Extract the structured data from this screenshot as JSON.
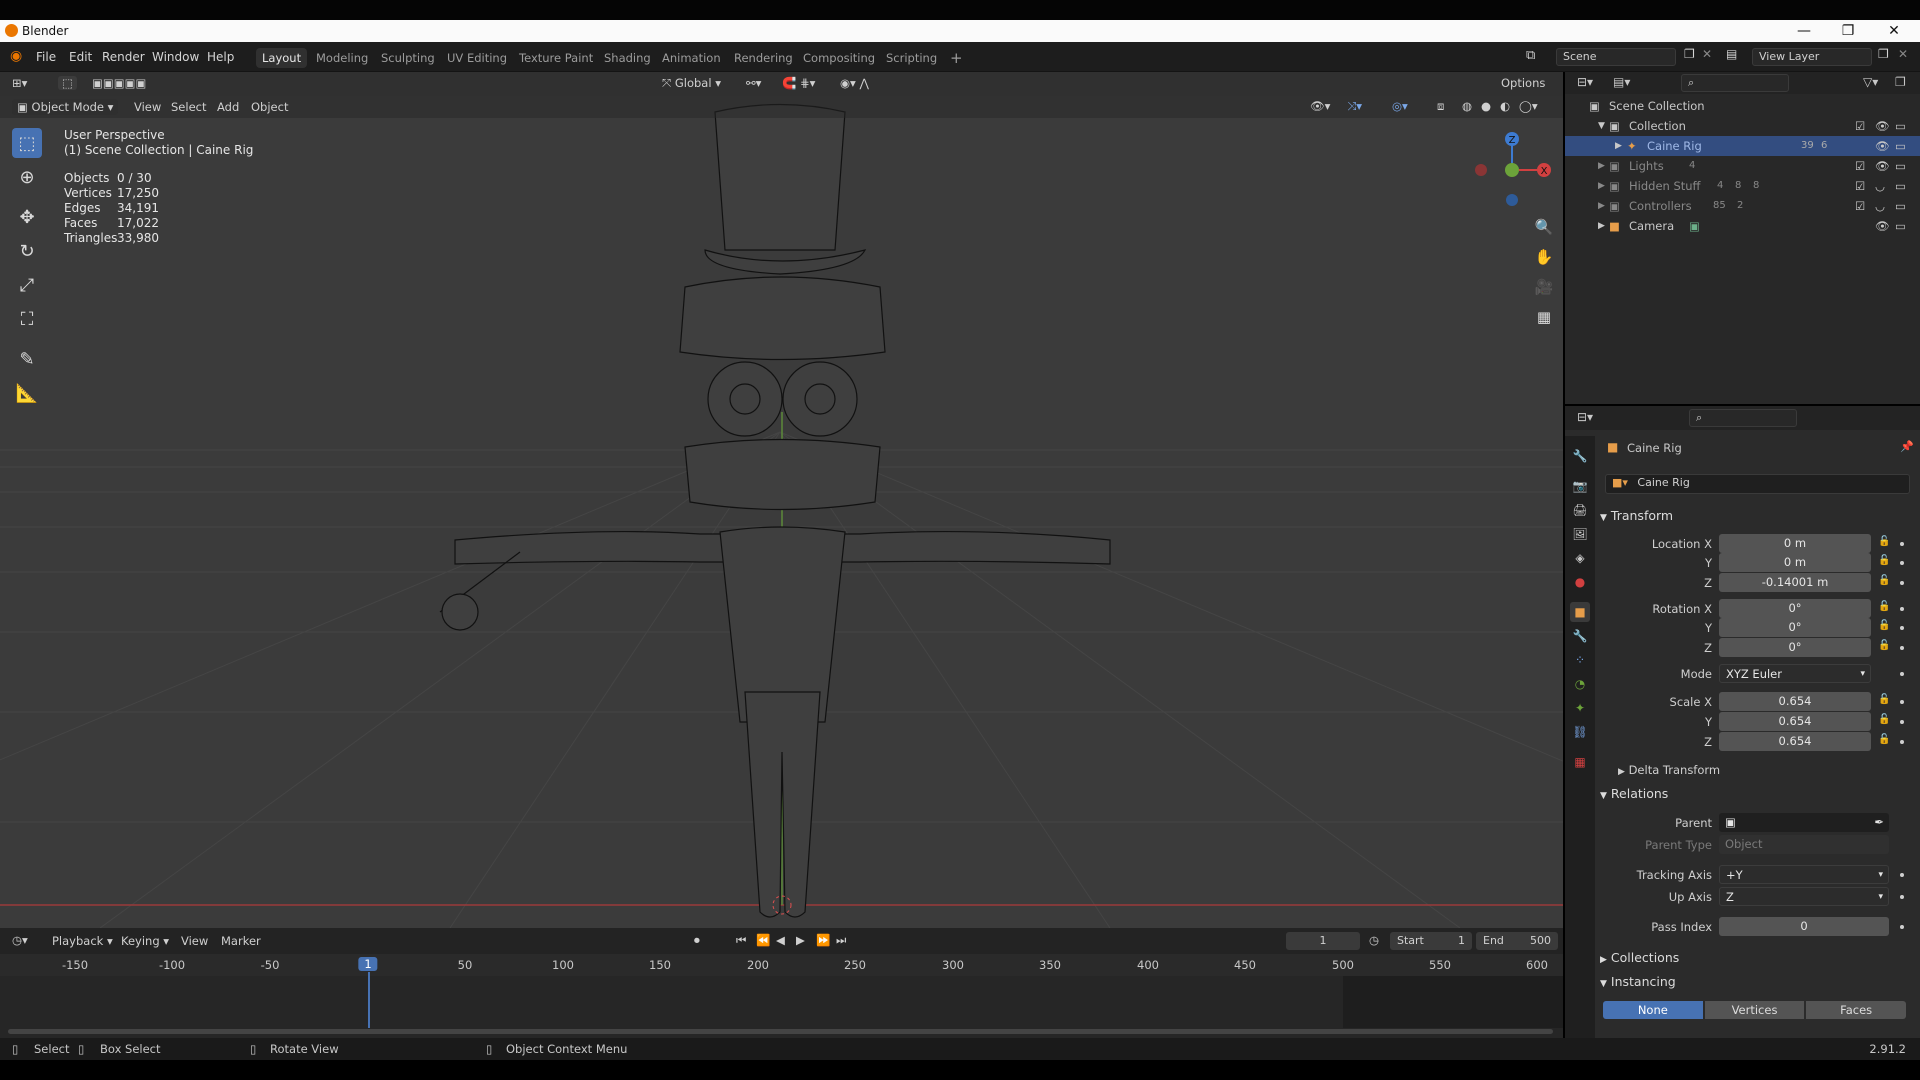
{
  "app": {
    "title": "Blender",
    "version": "2.91.2"
  },
  "menus": [
    "File",
    "Edit",
    "Render",
    "Window",
    "Help"
  ],
  "workspaces": [
    "Layout",
    "Modeling",
    "Sculpting",
    "UV Editing",
    "Texture Paint",
    "Shading",
    "Animation",
    "Rendering",
    "Compositing",
    "Scripting"
  ],
  "active_workspace": "Layout",
  "scene_name": "Scene",
  "view_layer": "View Layer",
  "viewport": {
    "mode": "Object Mode",
    "menus": [
      "View",
      "Select",
      "Add",
      "Object"
    ],
    "transform_orientation": "Global",
    "options_label": "Options",
    "perspective": "User Perspective",
    "context": "(1) Scene Collection | Caine Rig",
    "stats": [
      {
        "label": "Objects",
        "value": "0 / 30"
      },
      {
        "label": "Vertices",
        "value": "17,250"
      },
      {
        "label": "Edges",
        "value": "34,191"
      },
      {
        "label": "Faces",
        "value": "17,022"
      },
      {
        "label": "Triangles",
        "value": "33,980"
      }
    ],
    "gizmo_axes": {
      "x": "X",
      "z": "Z"
    }
  },
  "outliner": {
    "root": "Scene Collection",
    "items": [
      {
        "name": "Collection",
        "icon": "collection-icon"
      },
      {
        "name": "Caine Rig",
        "icon": "armature-icon",
        "selected": true,
        "badges": [
          "39",
          "6"
        ]
      },
      {
        "name": "Lights",
        "icon": "collection-icon",
        "badges": [
          "4"
        ]
      },
      {
        "name": "Hidden Stuff",
        "icon": "collection-icon",
        "badges": [
          "4",
          "8",
          "8"
        ]
      },
      {
        "name": "Controllers",
        "icon": "collection-icon",
        "badges": [
          "85",
          "2"
        ]
      },
      {
        "name": "Camera",
        "icon": "camera-icon"
      }
    ]
  },
  "properties": {
    "object_name": "Caine Rig",
    "data_name": "Caine Rig",
    "transform": {
      "title": "Transform",
      "location_label": "Location X",
      "location": [
        "0 m",
        "0 m",
        "-0.14001 m"
      ],
      "rotation_label": "Rotation X",
      "rotation": [
        "0°",
        "0°",
        "0°"
      ],
      "mode_label": "Mode",
      "mode": "XYZ Euler",
      "scale_label": "Scale X",
      "scale": [
        "0.654",
        "0.654",
        "0.654"
      ],
      "y": "Y",
      "z": "Z"
    },
    "delta_transform": "Delta Transform",
    "relations": {
      "title": "Relations",
      "parent_label": "Parent",
      "parent_type_label": "Parent Type",
      "parent_type": "Object",
      "tracking_axis_label": "Tracking Axis",
      "tracking_axis": "+Y",
      "up_axis_label": "Up Axis",
      "up_axis": "Z",
      "pass_index_label": "Pass Index",
      "pass_index": "0"
    },
    "collections": "Collections",
    "instancing": {
      "title": "Instancing",
      "options": [
        "None",
        "Vertices",
        "Faces"
      ],
      "selected": "None"
    }
  },
  "timeline": {
    "menus": [
      "Playback",
      "Keying",
      "View",
      "Marker"
    ],
    "current_frame": "1",
    "start_label": "Start",
    "start": "1",
    "end_label": "End",
    "end": "500",
    "ticks": [
      "-150",
      "-100",
      "-50",
      "1",
      "50",
      "100",
      "150",
      "200",
      "250",
      "300",
      "350",
      "400",
      "450",
      "500",
      "550",
      "600"
    ]
  },
  "statusbar": {
    "items": [
      "Select",
      "Box Select",
      "Rotate View",
      "Object Context Menu"
    ]
  }
}
